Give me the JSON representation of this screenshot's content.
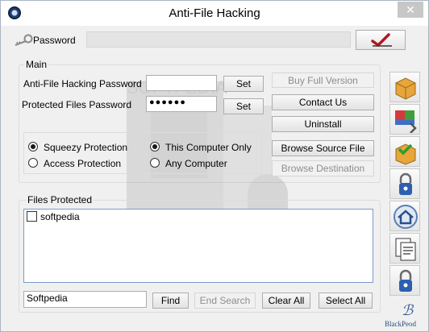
{
  "window": {
    "title": "Anti-File Hacking",
    "close_glyph": "✕"
  },
  "password_bar": {
    "label": "Password",
    "value": ""
  },
  "main": {
    "legend": "Main",
    "anti_hack_label": "Anti-File Hacking Password",
    "anti_hack_value": "",
    "protected_label": "Protected Files Password",
    "protected_value": "●●●●●●",
    "set_label": "Set",
    "buy_label": "Buy Full Version",
    "contact_label": "Contact Us",
    "uninstall_label": "Uninstall",
    "browse_source_label": "Browse Source File",
    "browse_dest_label": "Browse Destination",
    "radio_squeezy": "Squeezy Protection",
    "radio_access": "Access Protection",
    "radio_this_computer": "This Computer Only",
    "radio_any_computer": "Any Computer"
  },
  "files": {
    "legend": "Files Protected",
    "items": [
      "softpedia"
    ]
  },
  "search": {
    "value": "Softpedia",
    "find_label": "Find",
    "end_search_label": "End Search",
    "clear_all_label": "Clear All",
    "select_all_label": "Select All"
  },
  "sidebar_icons": [
    "box-icon",
    "move-files-icon",
    "archive-check-icon",
    "lock-icon",
    "home-icon",
    "documents-icon",
    "lock-icon"
  ],
  "brand": {
    "text": "BlackPeod"
  },
  "watermark": {
    "text": "SOFTPEDIA"
  }
}
